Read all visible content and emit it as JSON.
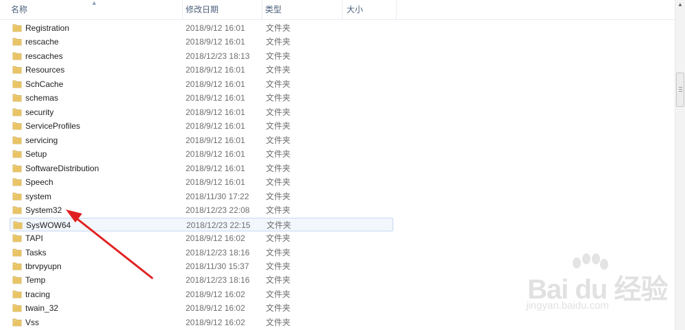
{
  "columns": {
    "name": "名称",
    "date": "修改日期",
    "type": "类型",
    "size": "大小"
  },
  "rows": [
    {
      "name": "Registration",
      "date": "2018/9/12 16:01",
      "type": "文件夹"
    },
    {
      "name": "rescache",
      "date": "2018/9/12 16:01",
      "type": "文件夹"
    },
    {
      "name": "rescaches",
      "date": "2018/12/23 18:13",
      "type": "文件夹"
    },
    {
      "name": "Resources",
      "date": "2018/9/12 16:01",
      "type": "文件夹"
    },
    {
      "name": "SchCache",
      "date": "2018/9/12 16:01",
      "type": "文件夹"
    },
    {
      "name": "schemas",
      "date": "2018/9/12 16:01",
      "type": "文件夹"
    },
    {
      "name": "security",
      "date": "2018/9/12 16:01",
      "type": "文件夹"
    },
    {
      "name": "ServiceProfiles",
      "date": "2018/9/12 16:01",
      "type": "文件夹"
    },
    {
      "name": "servicing",
      "date": "2018/9/12 16:01",
      "type": "文件夹"
    },
    {
      "name": "Setup",
      "date": "2018/9/12 16:01",
      "type": "文件夹"
    },
    {
      "name": "SoftwareDistribution",
      "date": "2018/9/12 16:01",
      "type": "文件夹"
    },
    {
      "name": "Speech",
      "date": "2018/9/12 16:01",
      "type": "文件夹"
    },
    {
      "name": "system",
      "date": "2018/11/30 17:22",
      "type": "文件夹"
    },
    {
      "name": "System32",
      "date": "2018/12/23 22:08",
      "type": "文件夹"
    },
    {
      "name": "SysWOW64",
      "date": "2018/12/23 22:15",
      "type": "文件夹",
      "selected": true
    },
    {
      "name": "TAPI",
      "date": "2018/9/12 16:02",
      "type": "文件夹"
    },
    {
      "name": "Tasks",
      "date": "2018/12/23 18:16",
      "type": "文件夹"
    },
    {
      "name": "tbrvpyupn",
      "date": "2018/11/30 15:37",
      "type": "文件夹"
    },
    {
      "name": "Temp",
      "date": "2018/12/23 18:16",
      "type": "文件夹"
    },
    {
      "name": "tracing",
      "date": "2018/9/12 16:02",
      "type": "文件夹"
    },
    {
      "name": "twain_32",
      "date": "2018/9/12 16:02",
      "type": "文件夹"
    },
    {
      "name": "Vss",
      "date": "2018/9/12 16:02",
      "type": "文件夹"
    }
  ],
  "icons": {
    "folder": "folder-icon",
    "sort": "sort-up-icon",
    "scroll_up": "scroll-up-arrow-icon",
    "annotation": "red-arrow-icon"
  },
  "colors": {
    "header_text": "#4c607a",
    "selected_bg": "#f2f7fd",
    "selected_border": "#c6d9f1",
    "annotation_arrow": "#e02020",
    "folder": "#e8c466"
  },
  "watermark": {
    "logo": "Bai du 经验",
    "url": "jingyan.baidu.com"
  }
}
